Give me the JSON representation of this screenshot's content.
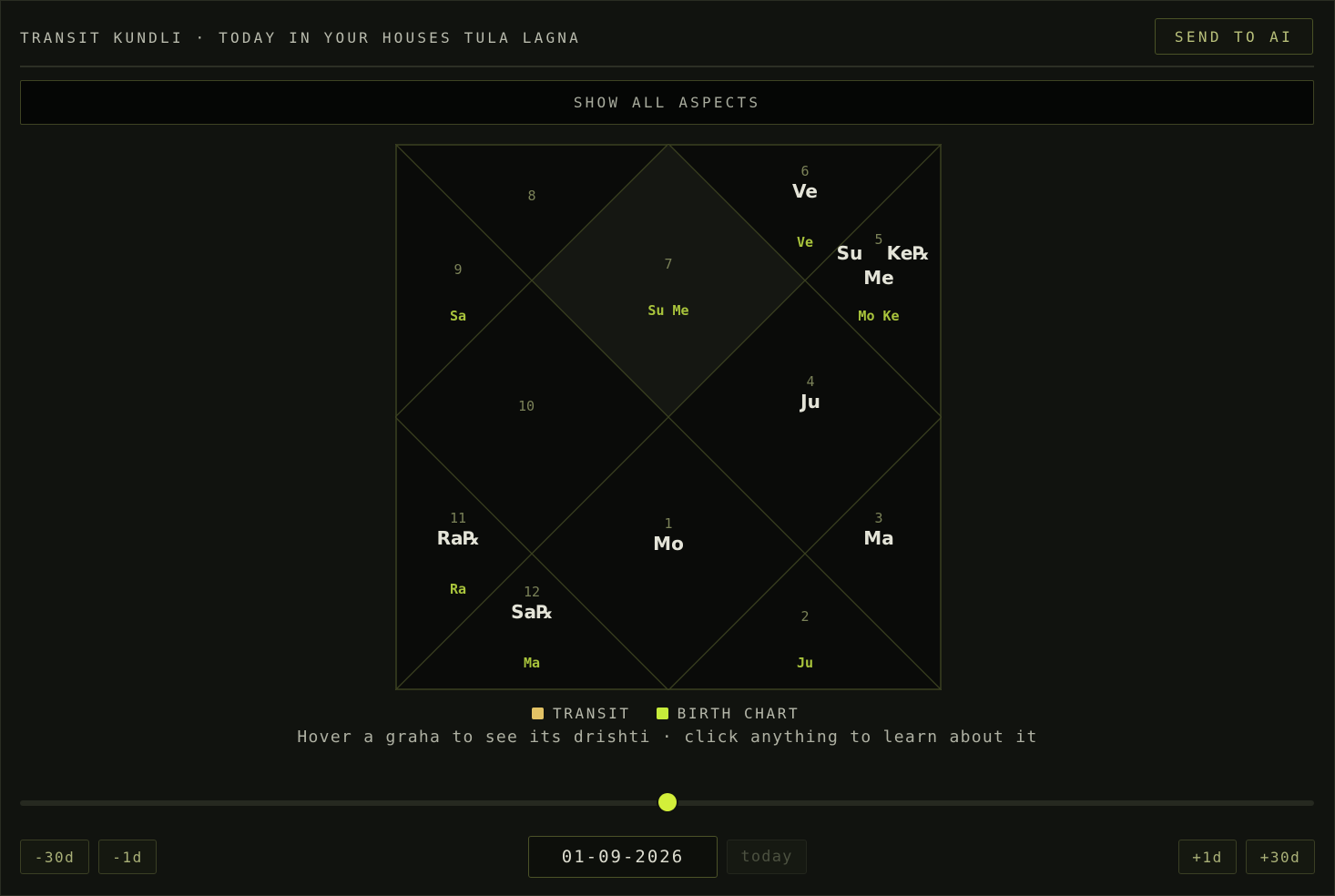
{
  "header": {
    "title": "TRANSIT KUNDLI · TODAY IN YOUR HOUSES TULA LAGNA",
    "send_label": "SEND TO AI"
  },
  "aspects_label": "SHOW ALL ASPECTS",
  "houses": {
    "h1": {
      "num": "1",
      "transit": "Mo",
      "birth": ""
    },
    "h2": {
      "num": "2",
      "transit": "",
      "birth": "Ju"
    },
    "h3": {
      "num": "3",
      "transit": "Ma",
      "birth": ""
    },
    "h4": {
      "num": "4",
      "transit": "Ju",
      "birth": ""
    },
    "h5": {
      "num": "5",
      "transit_a": "Su",
      "transit_b": "Ke℞",
      "transit_c": "Me",
      "birth": "Mo Ke"
    },
    "h6": {
      "num": "6",
      "transit": "Ve",
      "birth": "Ve"
    },
    "h7": {
      "num": "7",
      "transit": "",
      "birth": "Su Me"
    },
    "h8": {
      "num": "8",
      "transit": "",
      "birth": ""
    },
    "h9": {
      "num": "9",
      "transit": "",
      "birth": "Sa"
    },
    "h10": {
      "num": "10",
      "transit": "",
      "birth": ""
    },
    "h11": {
      "num": "11",
      "transit": "Ra℞",
      "birth": "Ra"
    },
    "h12": {
      "num": "12",
      "transit": "Sa℞",
      "birth": "Ma"
    }
  },
  "legend": {
    "transit": "TRANSIT",
    "transit_color": "#e2c265",
    "birth": "BIRTH CHART",
    "birth_color": "#c6ec3b"
  },
  "hint": "Hover a graha to see its drishti · click anything to learn about it",
  "timeline": {
    "slider_position_pct": 50,
    "minus30": "-30d",
    "minus1": "-1d",
    "date": "01-09-2026",
    "today": "today",
    "plus1": "+1d",
    "plus30": "+30d"
  },
  "colors": {
    "accent": "#d3ef3a",
    "chart_line": "#3b4120",
    "lagna_fill": "#151712"
  }
}
